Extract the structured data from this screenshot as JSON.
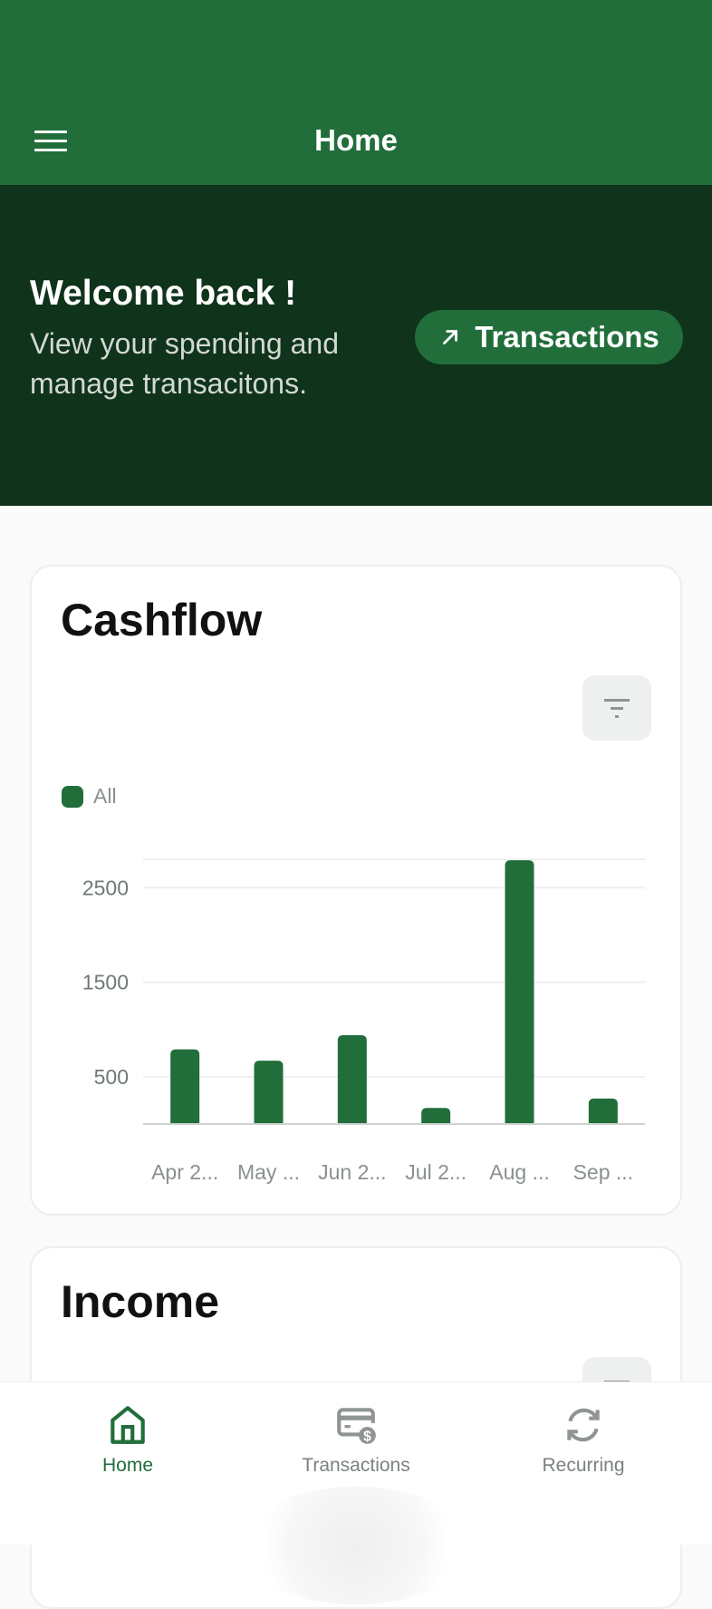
{
  "appbar": {
    "title": "Home",
    "menu_icon": "hamburger-menu-icon"
  },
  "hero": {
    "title": "Welcome back !",
    "subtitle": "View your spending and manage transacitons.",
    "button_label": "Transactions",
    "button_icon": "arrow-up-right-icon"
  },
  "colors": {
    "primary": "#216e3b",
    "hero_bg": "#10331b",
    "muted": "#7b827e"
  },
  "cards": [
    {
      "title": "Cashflow",
      "filter_icon": "filter-icon",
      "legend": [
        {
          "label": "All",
          "color": "#216e3b"
        }
      ]
    },
    {
      "title": "Income",
      "filter_icon": "filter-icon"
    }
  ],
  "chart_data": {
    "type": "bar",
    "title": "Cashflow",
    "categories": [
      "Apr 2...",
      "May ...",
      "Jun 2...",
      "Jul 2...",
      "Aug ...",
      "Sep ..."
    ],
    "series": [
      {
        "name": "All",
        "color": "#216e3b",
        "values": [
          790,
          670,
          940,
          170,
          2790,
          270
        ]
      }
    ],
    "yticks": [
      500,
      1500,
      2500
    ],
    "ylim": [
      0,
      2800
    ],
    "xlabel": "",
    "ylabel": "",
    "grid": true,
    "legend": "top-left"
  },
  "bottom_nav": [
    {
      "label": "Home",
      "icon": "home-icon",
      "active": true
    },
    {
      "label": "Transactions",
      "icon": "card-dollar-icon",
      "active": false
    },
    {
      "label": "Recurring",
      "icon": "refresh-icon",
      "active": false
    }
  ]
}
